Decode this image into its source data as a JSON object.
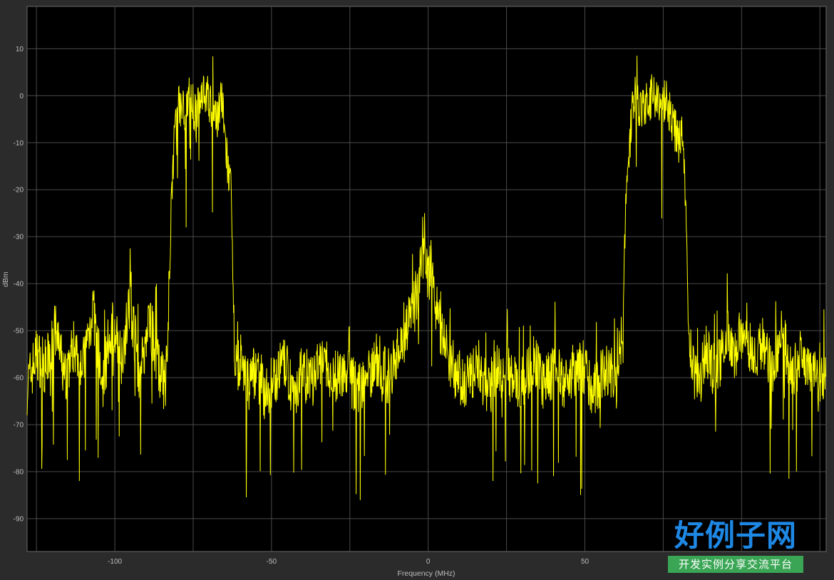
{
  "chart_data": {
    "type": "line",
    "xlabel": "Frequency (MHz)",
    "ylabel": "dBm",
    "xlim": [
      -128,
      127
    ],
    "ylim": [
      -97,
      19
    ],
    "xticks": [
      -100,
      -50,
      0,
      50
    ],
    "yticks": [
      10,
      0,
      -10,
      -20,
      -30,
      -40,
      -50,
      -60,
      -70,
      -80,
      -90
    ],
    "grid": true,
    "series": [
      {
        "color": "#ffff00",
        "x": [
          -128,
          -125,
          -122,
          -119,
          -116,
          -113,
          -110,
          -107,
          -104,
          -101,
          -98,
          -95,
          -92,
          -89,
          -86,
          -84,
          -83,
          -82,
          -81,
          -80,
          -78,
          -76,
          -74,
          -72,
          -70,
          -68,
          -66,
          -65,
          -64,
          -63,
          -62,
          -61,
          -60,
          -58,
          -55,
          -52,
          -49,
          -46,
          -43,
          -40,
          -37,
          -34,
          -31,
          -28,
          -25,
          -22,
          -19,
          -16,
          -13,
          -10,
          -8,
          -6,
          -4,
          -3,
          -2,
          -1,
          0,
          1,
          2,
          3,
          4,
          6,
          8,
          10,
          13,
          16,
          19,
          22,
          25,
          28,
          31,
          34,
          37,
          40,
          43,
          46,
          49,
          52,
          55,
          58,
          60,
          61,
          62,
          63,
          64,
          65,
          66,
          68,
          70,
          72,
          74,
          76,
          78,
          80,
          81,
          82,
          83,
          84,
          86,
          89,
          92,
          95,
          98,
          101,
          104,
          107,
          110,
          113,
          116,
          119,
          122,
          125,
          127
        ],
        "y": [
          -62,
          -55,
          -58,
          -50,
          -60,
          -53,
          -57,
          -45,
          -62,
          -48,
          -56,
          -44,
          -60,
          -47,
          -58,
          -62,
          -52,
          -25,
          -8,
          -2,
          -3,
          0,
          -5,
          2,
          -1,
          -6,
          0,
          -8,
          -15,
          -20,
          -50,
          -60,
          -55,
          -62,
          -58,
          -64,
          -60,
          -57,
          -63,
          -59,
          -61,
          -56,
          -62,
          -58,
          -60,
          -63,
          -59,
          -56,
          -60,
          -55,
          -52,
          -48,
          -44,
          -40,
          -36,
          -30,
          -40,
          -34,
          -42,
          -46,
          -50,
          -54,
          -58,
          -60,
          -61,
          -57,
          -63,
          -59,
          -58,
          -62,
          -60,
          -56,
          -62,
          -58,
          -61,
          -59,
          -57,
          -63,
          -60,
          -58,
          -62,
          -55,
          -50,
          -22,
          -12,
          -5,
          0,
          -3,
          -2,
          1,
          -4,
          0,
          -6,
          -10,
          -8,
          -20,
          -45,
          -58,
          -62,
          -54,
          -60,
          -50,
          -55,
          -48,
          -57,
          -52,
          -58,
          -50,
          -60,
          -55,
          -58,
          -62,
          -57
        ]
      }
    ]
  },
  "watermark": {
    "title": "好例子网",
    "subtitle": "开发实例分享交流平台"
  }
}
